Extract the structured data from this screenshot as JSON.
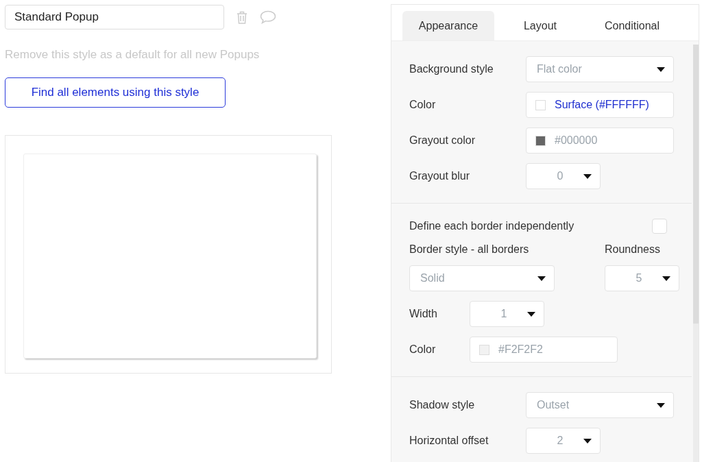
{
  "style_name": {
    "value": "Standard Popup"
  },
  "remove_default_link": "Remove this style as a default for all new Popups",
  "find_button": {
    "label": "Find all elements using this style"
  },
  "tabs": [
    {
      "label": "Appearance",
      "selected": true
    },
    {
      "label": "Layout",
      "selected": false
    },
    {
      "label": "Conditional",
      "selected": false
    }
  ],
  "sections": [
    {
      "rows": [
        {
          "kind": "select",
          "label": "Background style",
          "value": "Flat color"
        },
        {
          "kind": "color",
          "label": "Color",
          "value": "Surface (#FFFFFF)",
          "color": "#ffffff",
          "linked": true
        },
        {
          "kind": "color",
          "label": "Grayout color",
          "value": "#000000",
          "color": "#666666",
          "linked": false
        },
        {
          "kind": "select_small",
          "label": "Grayout blur",
          "value": "0"
        }
      ]
    },
    {
      "rows": [
        {
          "kind": "checkbox",
          "label": "Define each border independently",
          "checked": false
        },
        {
          "kind": "select_pair",
          "items": [
            {
              "label": "Border style - all borders",
              "value": "Solid"
            },
            {
              "label": "Roundness",
              "value": "5"
            }
          ]
        },
        {
          "kind": "select_small",
          "label": "Width",
          "value": "1"
        },
        {
          "kind": "color",
          "label": "Color",
          "value": "#F2F2F2",
          "color": "#f2f2f2",
          "linked": false
        }
      ]
    },
    {
      "rows": [
        {
          "kind": "select",
          "label": "Shadow style",
          "value": "Outset"
        },
        {
          "kind": "select_small",
          "label": "Horizontal offset",
          "value": "2"
        }
      ]
    }
  ]
}
